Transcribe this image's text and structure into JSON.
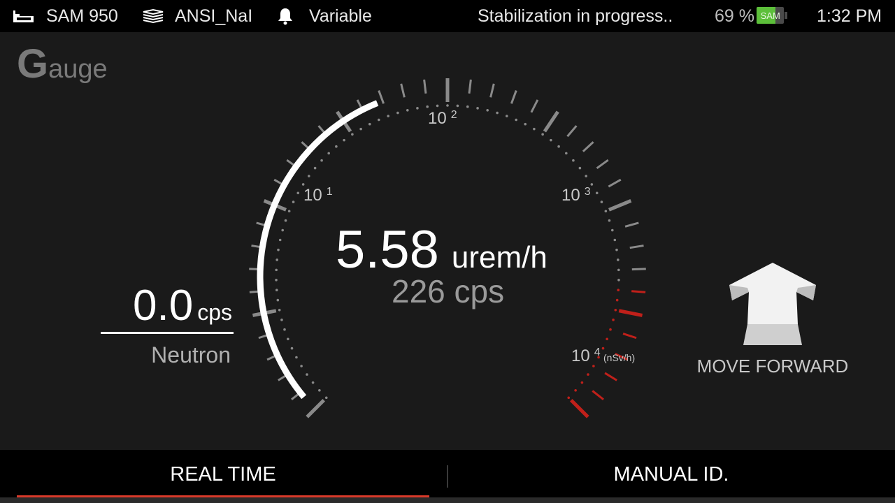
{
  "status_bar": {
    "device_name": "SAM 950",
    "library": "ANSI_NaI",
    "alarm_mode": "Variable",
    "message": "Stabilization in progress..",
    "battery_percent": "69 %",
    "battery_level": 0.69,
    "battery_label": "SAM",
    "time": "1:32 PM"
  },
  "screen": {
    "title_first": "G",
    "title_rest": "auge"
  },
  "gauge": {
    "scale_labels": [
      {
        "base": "10",
        "exp": "1"
      },
      {
        "base": "10",
        "exp": "2"
      },
      {
        "base": "10",
        "exp": "3"
      },
      {
        "base": "10",
        "exp": "4"
      }
    ],
    "scale_unit": "(nSv/h)",
    "dose_rate_value": "5.58",
    "dose_rate_unit": "urem/h",
    "count_rate": "226 cps",
    "colors": {
      "arc": "#ffffff",
      "tick": "#8a8a8a",
      "alarm_tick": "#c0201a",
      "dot": "#8a8a8a"
    }
  },
  "neutron": {
    "value": "0.0",
    "unit": "cps",
    "label": "Neutron"
  },
  "direction": {
    "icon": "arrow-up-icon",
    "label": "MOVE FORWARD"
  },
  "tabs": [
    {
      "label": "REAL TIME",
      "active": true
    },
    {
      "label": "MANUAL ID.",
      "active": false
    }
  ],
  "accent_color": "#d93a2a"
}
